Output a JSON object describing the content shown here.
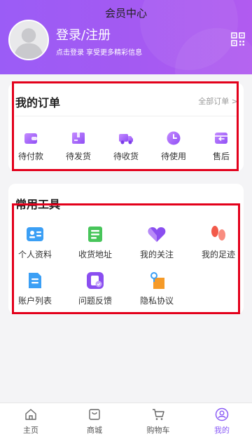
{
  "header": {
    "title": "会员中心",
    "login_title": "登录/注册",
    "login_subtitle": "点击登录 享受更多精彩信息",
    "accent": "#a35af2"
  },
  "orders": {
    "title": "我的订单",
    "all_orders": "全部订单 >",
    "items": [
      {
        "label": "待付款",
        "icon": "wallet-icon"
      },
      {
        "label": "待发货",
        "icon": "box-icon"
      },
      {
        "label": "待收货",
        "icon": "truck-icon"
      },
      {
        "label": "待使用",
        "icon": "clock-icon"
      },
      {
        "label": "售后",
        "icon": "return-icon"
      }
    ]
  },
  "tools": {
    "title": "常用工具",
    "items": [
      {
        "label": "个人资料",
        "icon": "profile-card-icon"
      },
      {
        "label": "收货地址",
        "icon": "address-icon"
      },
      {
        "label": "我的关注",
        "icon": "heart-icon"
      },
      {
        "label": "我的足迹",
        "icon": "footprint-icon"
      },
      {
        "label": "账户列表",
        "icon": "account-list-icon"
      },
      {
        "label": "问题反馈",
        "icon": "feedback-icon"
      },
      {
        "label": "隐私协议",
        "icon": "privacy-icon"
      }
    ]
  },
  "tabbar": {
    "items": [
      {
        "label": "主页",
        "icon": "home-icon"
      },
      {
        "label": "商城",
        "icon": "shop-bag-icon"
      },
      {
        "label": "购物车",
        "icon": "cart-icon"
      },
      {
        "label": "我的",
        "icon": "user-icon"
      }
    ],
    "active_color": "#8b5cf6"
  }
}
